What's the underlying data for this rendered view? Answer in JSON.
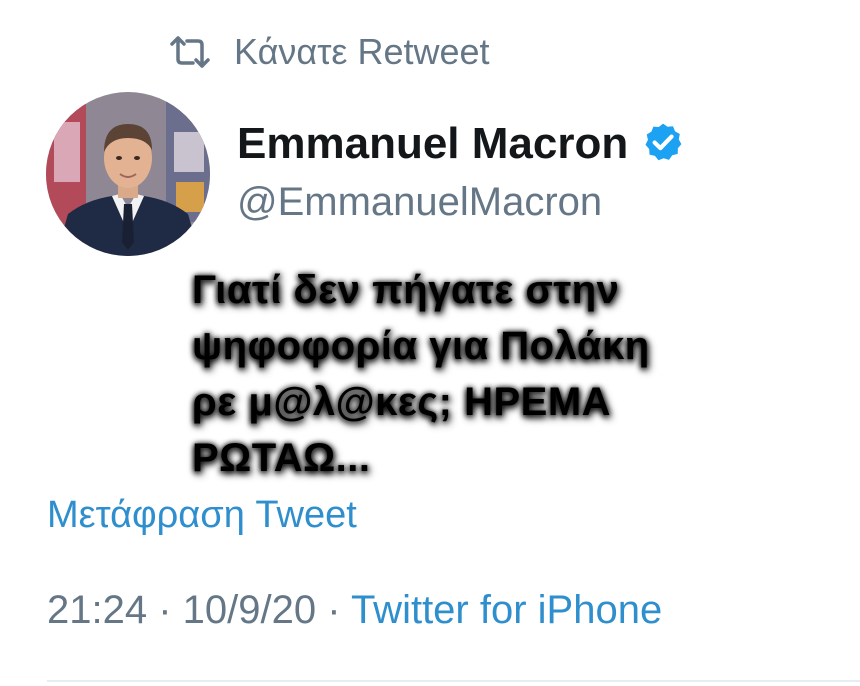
{
  "retweet": {
    "label": "Κάνατε Retweet",
    "icon": "retweet-icon"
  },
  "author": {
    "display_name": "Emmanuel Macron",
    "handle": "@EmmanuelMacron",
    "verified": true,
    "verified_icon": "verified-badge-icon",
    "avatar": "profile-photo"
  },
  "tweet": {
    "text": "Γιατί δεν πήγατε στην\nψηφοφορία για Πολάκη\nρε μ@λ@κες; ΗΡΕΜΑ\nΡΩΤΑΩ..."
  },
  "translate": {
    "label": "Μετάφραση Tweet"
  },
  "meta": {
    "time": "21:24",
    "separator1": " · ",
    "date": "10/9/20",
    "separator2": " · ",
    "source": "Twitter for iPhone"
  },
  "colors": {
    "secondary_text": "#657786",
    "link": "#2f8fce",
    "verified": "#1da1f2",
    "primary_text": "#14171a"
  }
}
